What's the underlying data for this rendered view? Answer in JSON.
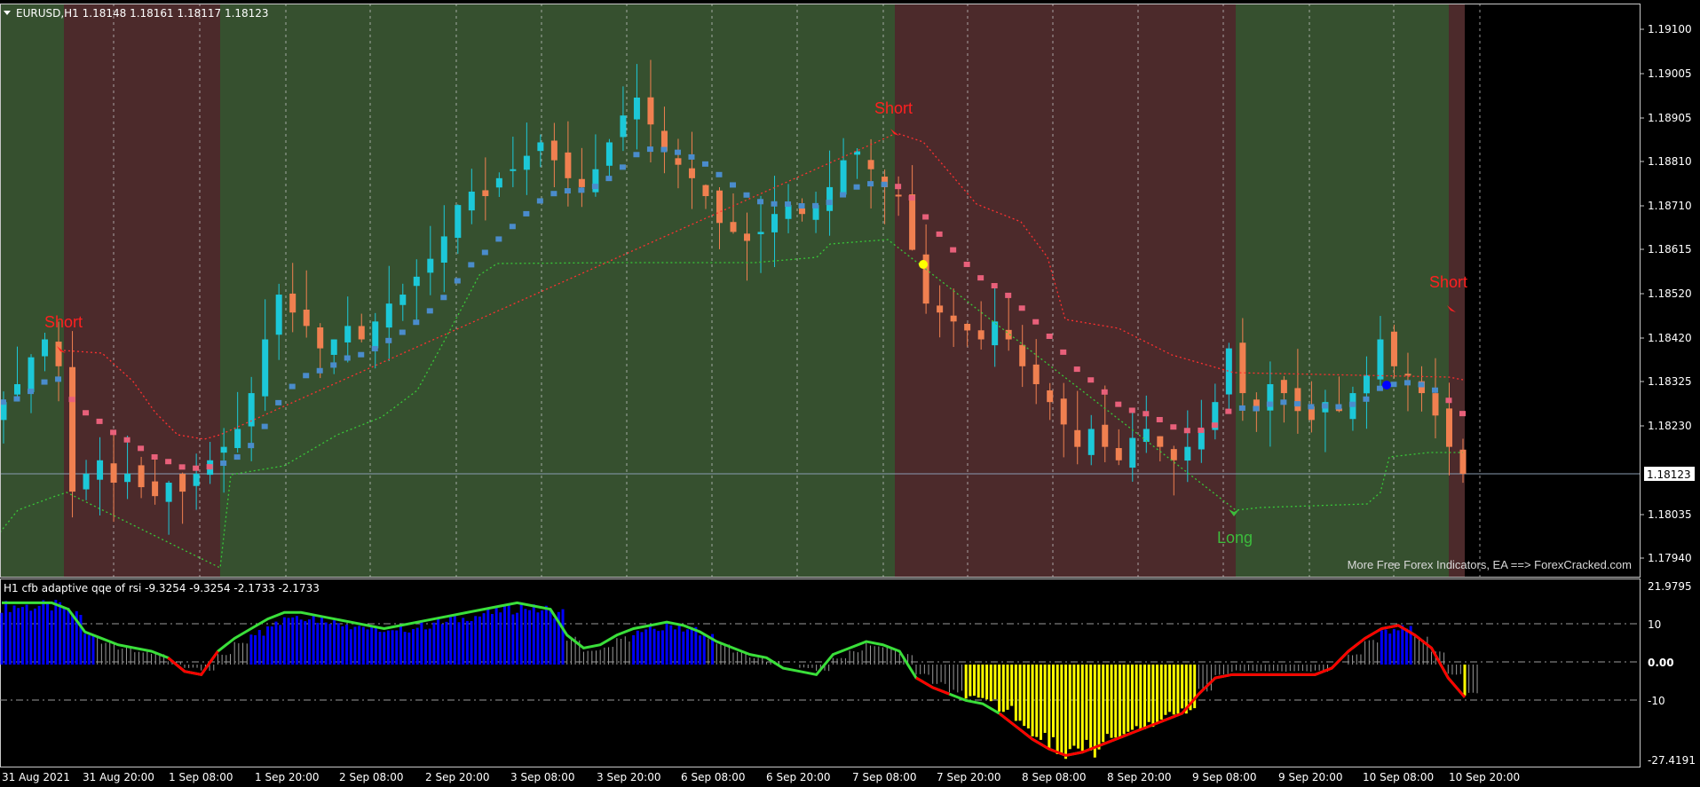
{
  "main": {
    "header": "EURUSD,H1  1.18148 1.18161 1.18117 1.18123",
    "price_labels": [
      "1.19100",
      "1.19005",
      "1.18905",
      "1.18810",
      "1.18710",
      "1.18615",
      "1.18520",
      "1.18420",
      "1.18325",
      "1.18230",
      "1.18123",
      "1.18035",
      "1.17940"
    ],
    "current_price": "1.18123",
    "signals": [
      {
        "text": "Short",
        "color": "#ff2020"
      },
      {
        "text": "Short",
        "color": "#ff2020"
      },
      {
        "text": "Short",
        "color": "#ff2020"
      },
      {
        "text": "Long",
        "color": "#3cbc3c"
      }
    ],
    "watermark": "More Free Forex Indicators, EA ==> ForexCracked.com",
    "colors": {
      "bull_zone": "#36502f",
      "bear_zone": "#4c2a2b",
      "bull_candle": "#1cc8d8",
      "bear_candle": "#f08050",
      "ma_up": "#4a8ccc",
      "ma_down": "#e8607a"
    }
  },
  "sub": {
    "header": "H1  cfb adaptive qqe of rsi -9.3254 -9.3254 -2.1733 -2.1733",
    "levels": [
      "21.9795",
      "10",
      "0.00",
      "-10",
      "-27.4191"
    ],
    "colors": {
      "pos": "#0000ff",
      "neg": "#ffff00",
      "line_up": "#3adf3a",
      "line_down": "#ff0000"
    }
  },
  "time_labels": [
    "31 Aug 2021",
    "31 Aug 20:00",
    "1 Sep 08:00",
    "1 Sep 20:00",
    "2 Sep 08:00",
    "2 Sep 20:00",
    "3 Sep 08:00",
    "3 Sep 20:00",
    "6 Sep 08:00",
    "6 Sep 20:00",
    "7 Sep 08:00",
    "7 Sep 20:00",
    "8 Sep 08:00",
    "8 Sep 20:00",
    "9 Sep 08:00",
    "9 Sep 20:00",
    "10 Sep 08:00",
    "10 Sep 20:00"
  ],
  "chart_data": {
    "type": "candlestick",
    "symbol": "EURUSD",
    "timeframe": "H1",
    "last_bar": {
      "open": 1.18148,
      "high": 1.18161,
      "low": 1.18117,
      "close": 1.18123
    },
    "ylim": [
      1.1789,
      1.1917
    ],
    "close_series": [
      1.1828,
      1.1832,
      1.1838,
      1.1842,
      1.1836,
      1.1808,
      1.1812,
      1.1815,
      1.181,
      1.1812,
      1.1809,
      1.1807,
      1.181,
      1.1808,
      1.1812,
      1.1815,
      1.1818,
      1.1822,
      1.183,
      1.1842,
      1.1852,
      1.1848,
      1.1845,
      1.184,
      1.1842,
      1.1845,
      1.1842,
      1.1846,
      1.185,
      1.1852,
      1.1856,
      1.186,
      1.1865,
      1.1872,
      1.1875,
      1.1874,
      1.1878,
      1.188,
      1.1883,
      1.1886,
      1.1882,
      1.1878,
      1.1876,
      1.188,
      1.1886,
      1.1892,
      1.1896,
      1.189,
      1.1884,
      1.1881,
      1.1878,
      1.1874,
      1.1868,
      1.1866,
      1.1864,
      1.1866,
      1.187,
      1.1872,
      1.187,
      1.1872,
      1.1876,
      1.1882,
      1.1884,
      1.188,
      1.1876,
      1.1874,
      1.1862,
      1.185,
      1.1848,
      1.1846,
      1.1844,
      1.1842,
      1.1846,
      1.1842,
      1.1836,
      1.1832,
      1.1828,
      1.1823,
      1.1818,
      1.1822,
      1.1818,
      1.1815,
      1.182,
      1.1822,
      1.1818,
      1.1815,
      1.1818,
      1.1822,
      1.1828,
      1.184,
      1.183,
      1.1826,
      1.1832,
      1.183,
      1.1826,
      1.1824,
      1.1828,
      1.1826,
      1.183,
      1.1834,
      1.1842,
      1.1836,
      1.1834,
      1.183,
      1.1825,
      1.1818,
      1.1812
    ],
    "qqe_series": [
      18,
      18,
      18,
      18,
      16,
      9,
      7,
      5,
      4,
      3,
      1,
      -1,
      -2,
      3,
      7,
      10,
      13,
      15,
      15,
      14,
      13,
      12,
      11,
      10,
      11,
      12,
      13,
      14,
      15,
      16,
      17,
      18,
      17,
      16,
      8,
      4,
      5,
      8,
      10,
      11,
      12,
      11,
      9,
      6,
      4,
      2,
      1,
      0,
      -1,
      -2,
      2,
      4,
      6,
      5,
      3,
      -3,
      -6,
      -8,
      -10,
      -11,
      -14,
      -18,
      -22,
      -25,
      -27,
      -26,
      -24,
      -22,
      -20,
      -18,
      -16,
      -14,
      -8,
      -3,
      -2,
      -2,
      -2,
      -2,
      -2,
      -2,
      0,
      3,
      7,
      10,
      11,
      8,
      4,
      -3,
      -9
    ]
  }
}
